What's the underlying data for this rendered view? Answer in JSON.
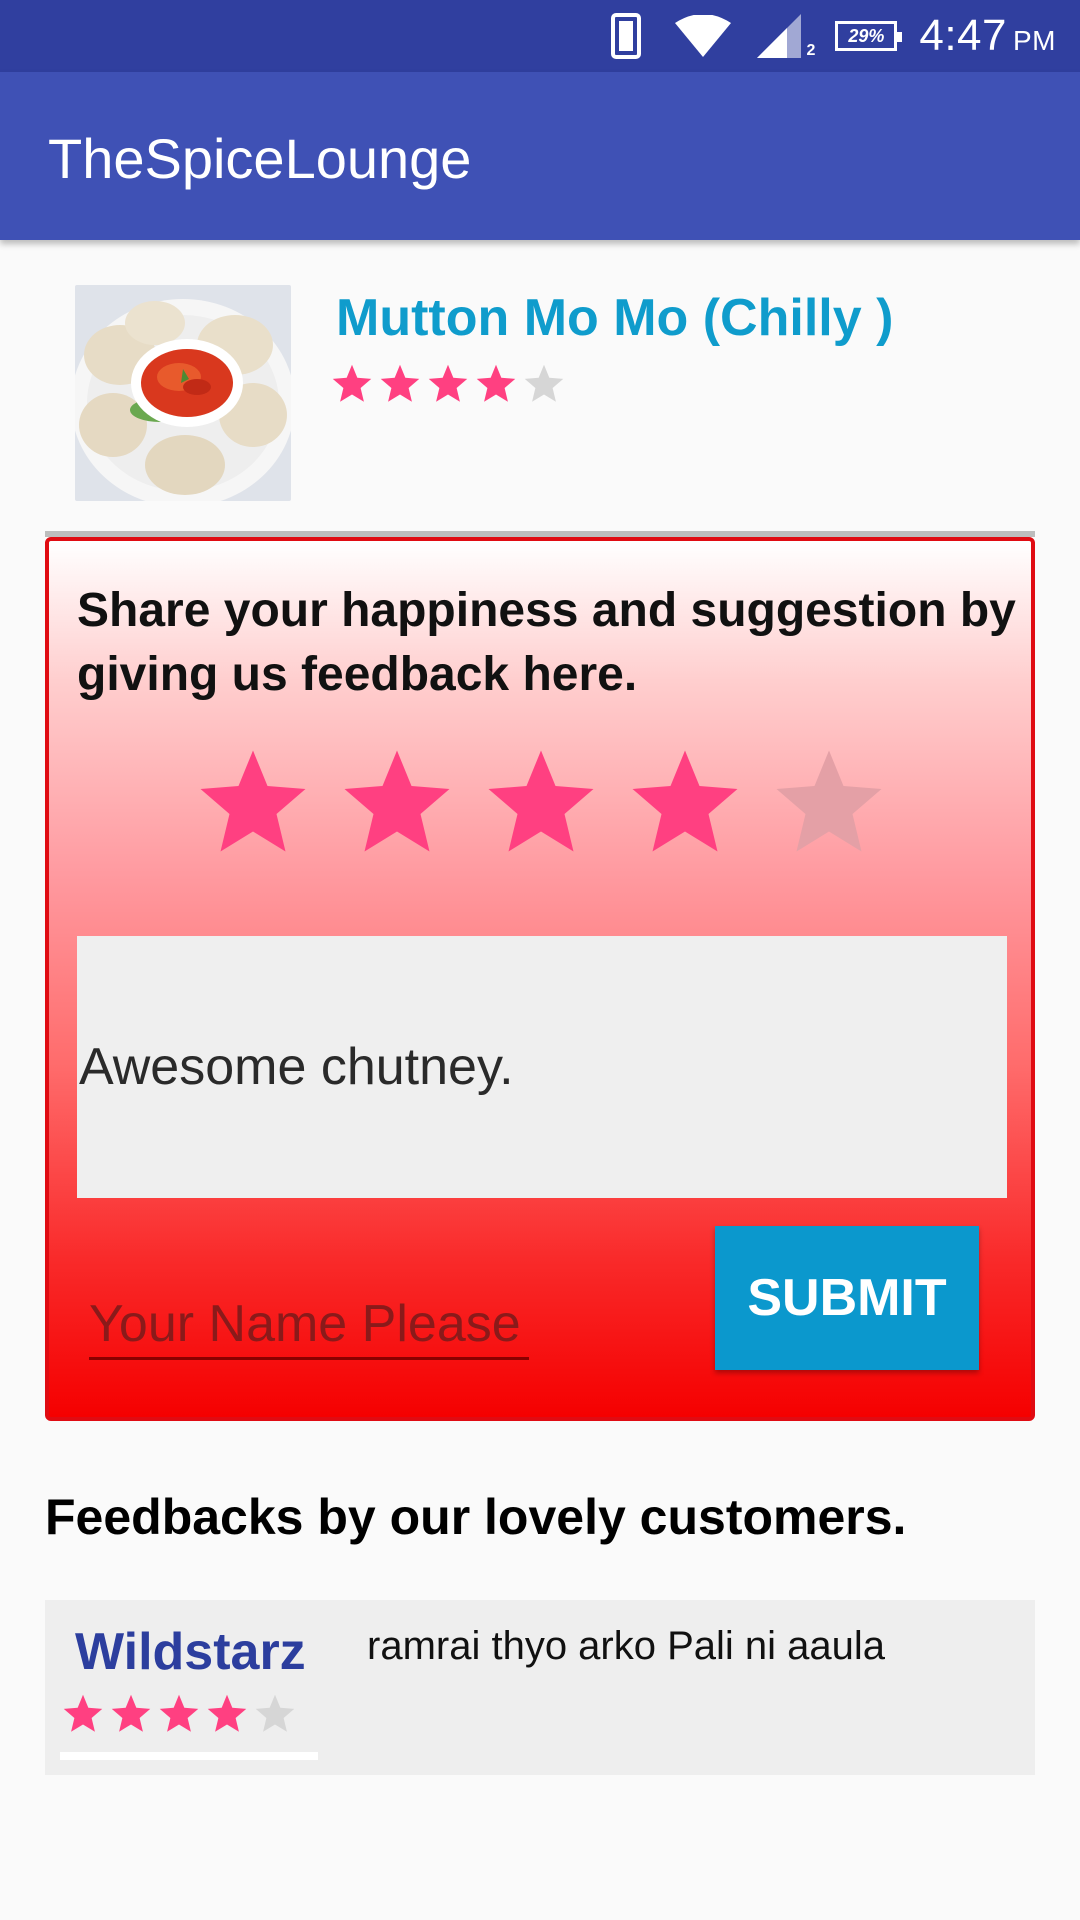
{
  "status_bar": {
    "time": "4:47",
    "ampm": "PM",
    "battery": "29%",
    "icons": [
      "phone-icon",
      "wifi-icon",
      "signal-icon",
      "battery-icon"
    ],
    "sim_label": "2"
  },
  "app_bar": {
    "title": "TheSpiceLounge"
  },
  "dish": {
    "name": "Mutton Mo Mo (Chilly )",
    "rating": 4,
    "max_rating": 5,
    "image": "momo-dish-photo"
  },
  "feedback_form": {
    "heading": "Share your happiness and suggestion by giving us feedback here.",
    "rating": 4,
    "max_rating": 5,
    "comment": "Awesome chutney.",
    "name_placeholder": "Your Name Please",
    "submit_label": "SUBMIT"
  },
  "reviews": {
    "heading": "Feedbacks by our lovely customers.",
    "items": [
      {
        "name": "Wildstarz",
        "rating": 4,
        "max_rating": 5,
        "text": "ramrai thyo arko Pali ni aaula"
      }
    ]
  },
  "colors": {
    "status_bar": "#303f9f",
    "app_bar": "#3f51b5",
    "star_filled": "#ff4081",
    "star_empty": "#d6d6d6",
    "dish_name": "#0f9ccc",
    "submit": "#0b98cd",
    "card_border": "#e00b12",
    "reviewer_name": "#2c3e9e"
  }
}
